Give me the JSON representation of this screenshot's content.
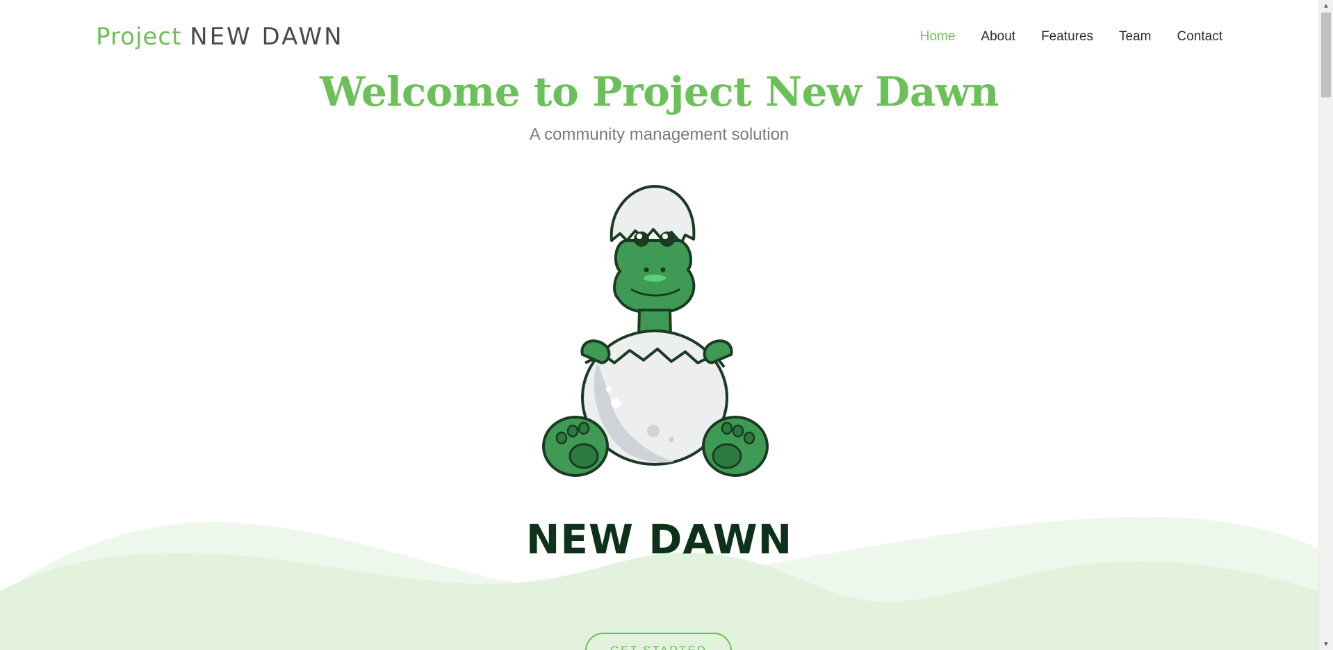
{
  "brand": {
    "part1": "Project",
    "part2": "NEW DAWN"
  },
  "nav": {
    "items": [
      {
        "label": "Home",
        "active": true
      },
      {
        "label": "About",
        "active": false
      },
      {
        "label": "Features",
        "active": false
      },
      {
        "label": "Team",
        "active": false
      },
      {
        "label": "Contact",
        "active": false
      }
    ]
  },
  "hero": {
    "title": "Welcome to Project New Dawn",
    "subtitle": "A community management solution",
    "logo_wordmark": "NEW DAWN",
    "cta_label": "GET STARTED"
  },
  "colors": {
    "accent": "#6cc05a",
    "text": "#2b2b2b",
    "wordmark": "#0e3219",
    "wave_light": "#eef7eb",
    "wave_mid": "#e2f2dd"
  },
  "icons": {
    "scroll_up": "scroll-up-arrow-icon",
    "scroll_down": "scroll-down-arrow-icon"
  }
}
